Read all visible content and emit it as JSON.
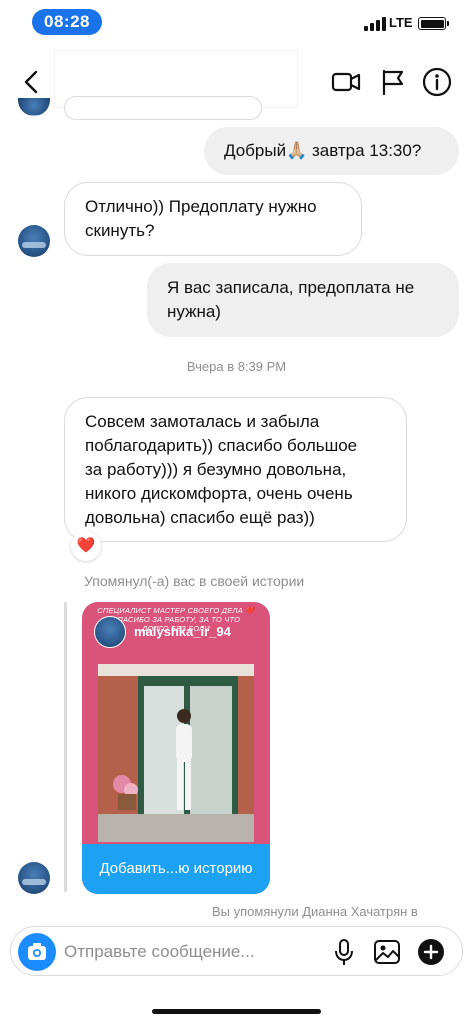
{
  "status_bar": {
    "time": "08:28",
    "network": "LTE"
  },
  "header": {
    "back_icon": "chevron-left-icon",
    "actions": [
      "video-call-icon",
      "flag-icon",
      "info-icon"
    ]
  },
  "messages": [
    {
      "sender": "me",
      "text": "Добрый🙏🏼 завтра 13:30?"
    },
    {
      "sender": "them",
      "lines": [
        "Отлично)) Предоплату нужно",
        "скинуть?"
      ]
    },
    {
      "sender": "me",
      "lines": [
        "Я вас записала, предоплата не",
        "нужна)"
      ]
    }
  ],
  "timestamp": "Вчера в 8:39 PM",
  "long_message": {
    "sender": "them",
    "lines": [
      "Совсем замоталась и забыла",
      "поблагодарить)) спасибо большое",
      "за работу))) я безумно довольна,",
      "никого дискомфорта, очень очень",
      "довольна) спасибо ещё раз))"
    ],
    "reaction": "❤️"
  },
  "story_mention": {
    "label": "Упомянул(-а) вас в своей истории",
    "top_text_lines": [
      "СПЕЦИАЛИСТ МАСТЕР СВОЕГО ДЕЛА ❤️",
      "СПАСИБО ЗА РАБОТУ, ЗА ТО ЧТО",
      "ДОЛГО БЕЗ БОЛИ"
    ],
    "username": "malyshka_ir_94",
    "action": "Добавить...ю историю"
  },
  "partial_note": "Вы упомянули Дианна Хачатрян в",
  "composer": {
    "placeholder": "Отправьте сообщение...",
    "icons": [
      "camera-icon",
      "microphone-icon",
      "gallery-icon",
      "add-icon"
    ]
  },
  "colors": {
    "accent": "#1a73e8",
    "camera_button": "#1a8cff",
    "story_bg": "#d9537a",
    "story_action": "#1da1f2",
    "incoming_border": "#dbdbdb",
    "outgoing_bg": "#efefef",
    "muted_text": "#8e8e8e"
  }
}
